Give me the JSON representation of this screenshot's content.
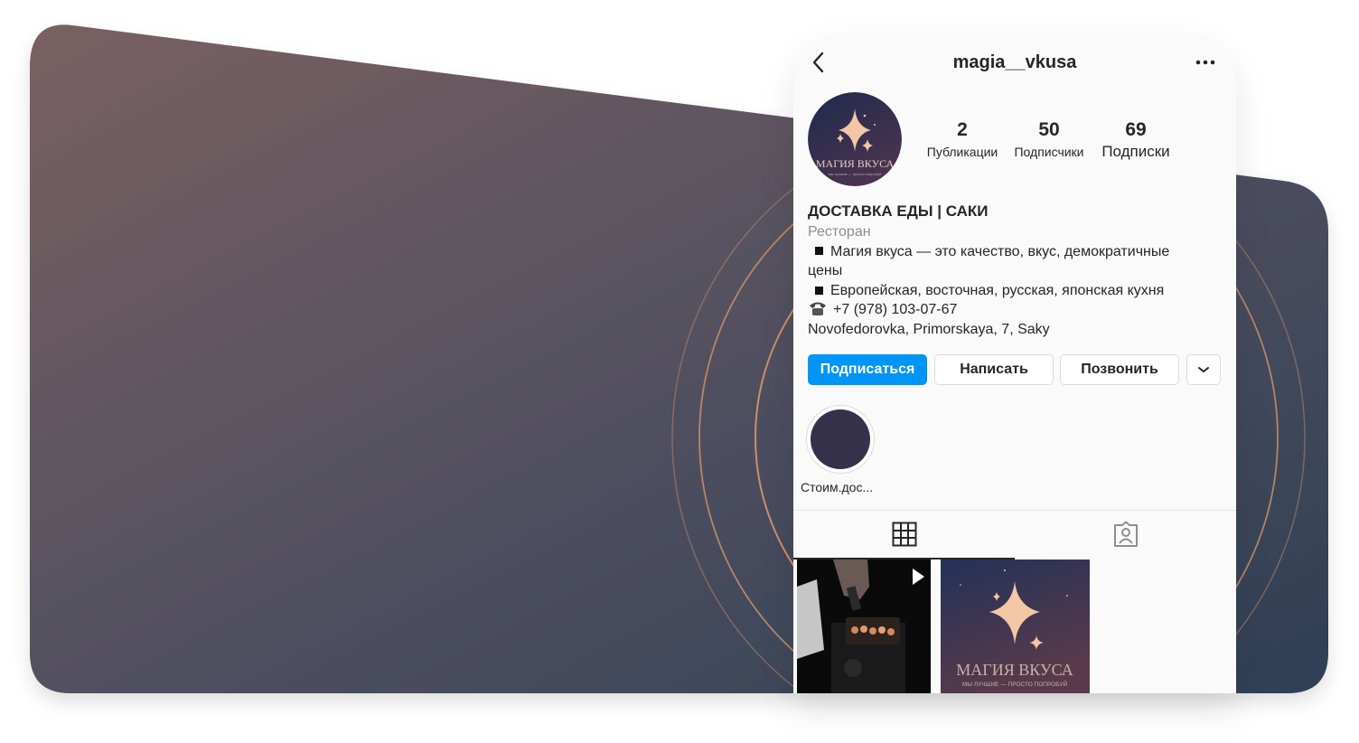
{
  "profile": {
    "username": "magia__vkusa",
    "avatar_text": "МАГИЯ ВКУСА",
    "avatar_tagline": "мы лучшие — просто попробуй"
  },
  "stats": [
    {
      "value": "2",
      "label": "Публикации"
    },
    {
      "value": "50",
      "label": "Подписчики"
    },
    {
      "value": "69",
      "label": "Подписки"
    }
  ],
  "bio": {
    "name": "ДОСТАВКА ЕДЫ | САКИ",
    "category": "Ресторан",
    "line1": "Магия вкуса — это качество, вкус, демократичные",
    "line1_cont": "цены",
    "line2": "Европейская, восточная, русская, японская кухня",
    "phone": "+7 (978) 103-07-67",
    "address": "Novofedorovka, Primorskaya, 7, Saky"
  },
  "actions": {
    "follow": "Подписаться",
    "message": "Написать",
    "call": "Позвонить"
  },
  "highlights": [
    {
      "label": "Стоим.дос..."
    }
  ],
  "tabs": [
    {
      "name": "grid",
      "icon": "grid-icon",
      "active": true
    },
    {
      "name": "tagged",
      "icon": "tagged-user-icon",
      "active": false
    }
  ],
  "posts": [
    {
      "type": "video",
      "icon": "play-icon"
    },
    {
      "type": "image",
      "title": "МАГИЯ ВКУСА",
      "tagline": "МЫ ЛУЧШИЕ — ПРОСТО ПОПРОБУЙ"
    }
  ],
  "colors": {
    "primary_button": "#0095f6",
    "bg_gradient_start": "#7a6062",
    "bg_gradient_end": "#2f3f55",
    "ring": "#c9906a",
    "star": "#f3c7a4"
  }
}
